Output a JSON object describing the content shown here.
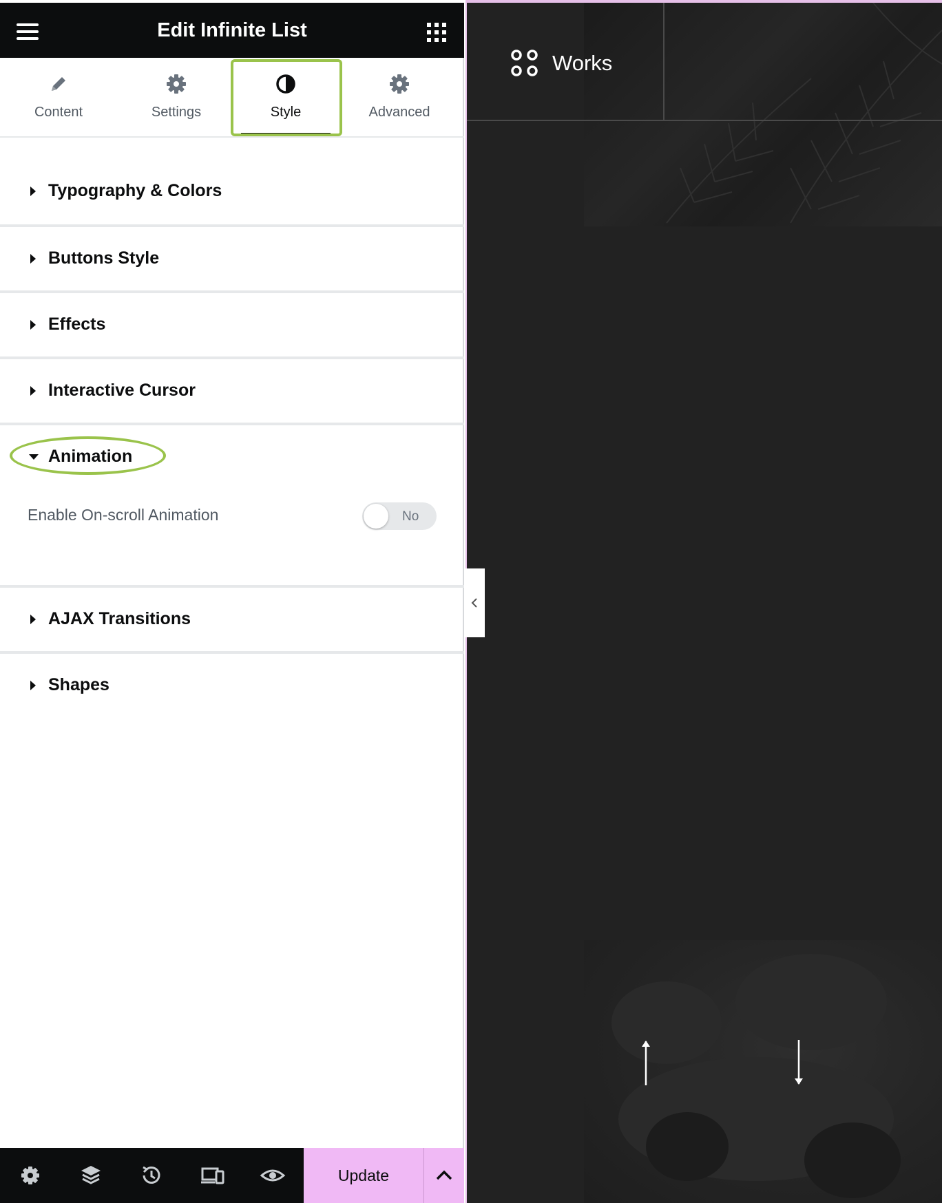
{
  "panel": {
    "title": "Edit Infinite List",
    "tabs": [
      {
        "label": "Content",
        "icon": "pencil-icon"
      },
      {
        "label": "Settings",
        "icon": "gear-icon"
      },
      {
        "label": "Style",
        "icon": "half-circle-icon",
        "active": true
      },
      {
        "label": "Advanced",
        "icon": "gear-icon"
      }
    ],
    "sections": [
      {
        "title": "Typography & Colors",
        "expanded": false
      },
      {
        "title": "Buttons Style",
        "expanded": false
      },
      {
        "title": "Effects",
        "expanded": false
      },
      {
        "title": "Interactive Cursor",
        "expanded": false
      },
      {
        "title": "Animation",
        "expanded": true
      },
      {
        "title": "AJAX Transitions",
        "expanded": false
      },
      {
        "title": "Shapes",
        "expanded": false
      }
    ],
    "animation": {
      "control_label": "Enable On-scroll Animation",
      "toggle_value": "No"
    },
    "footer": {
      "icons": [
        "gear-icon",
        "layers-icon",
        "history-icon",
        "responsive-icon",
        "eye-icon"
      ],
      "update_label": "Update"
    }
  },
  "preview": {
    "nav_label": "Works",
    "highlight_color": "#9ac34b",
    "accent_color": "#f0b9f5"
  }
}
